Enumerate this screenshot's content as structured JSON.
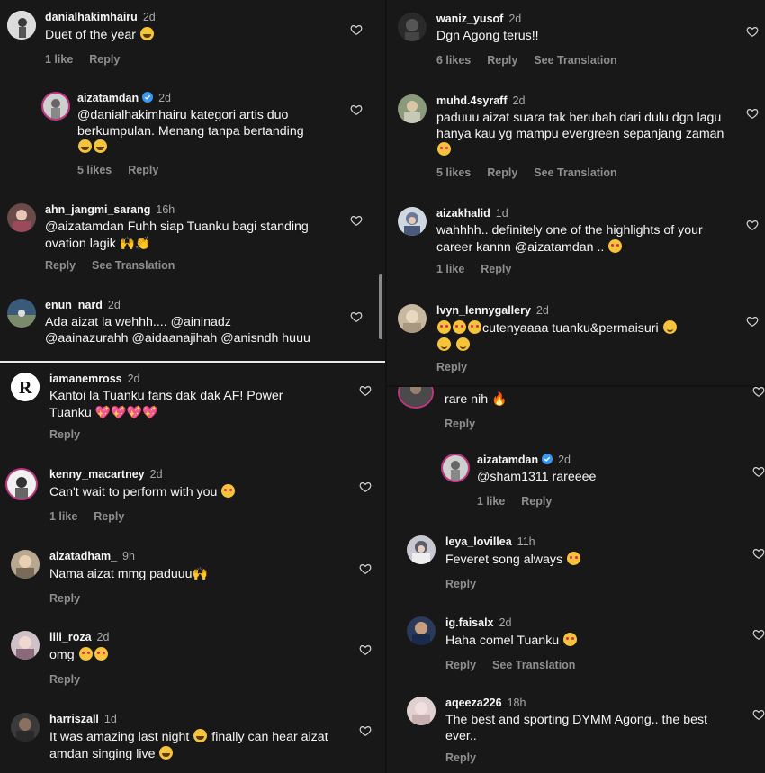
{
  "colors": {
    "background": "#181818",
    "text": "#f5f5f5",
    "muted": "#8e8e8e",
    "verified": "#3897f0"
  },
  "labels": {
    "reply": "Reply",
    "see_translation": "See Translation"
  },
  "top_left": [
    {
      "username": "danialhakimhairu",
      "time": "2d",
      "text": "Duet of the year",
      "emojis": "laugh",
      "likes": "1 like"
    },
    {
      "username": "aizatamdan",
      "verified": true,
      "time": "2d",
      "text": "@danialhakimhairu kategori artis duo berkumpulan. Menang tanpa bertanding",
      "emojis": "laugh laugh",
      "likes": "5 likes"
    },
    {
      "username": "ahn_jangmi_sarang",
      "time": "16h",
      "text": "@aizatamdan Fuhh siap Tuanku bagi standing ovation lagik",
      "emojis": "🙌👏",
      "translation": true
    },
    {
      "username": "enun_nard",
      "time": "2d",
      "text": "Ada aizat la wehhh.... @aininadz @aainazurahh @aidaanajihah @anisndh huuu"
    }
  ],
  "top_right": [
    {
      "username": "waniz_yusof",
      "time": "2d",
      "text": "Dgn Agong terus!!",
      "likes": "6 likes",
      "translation": true
    },
    {
      "username": "muhd.4syraff",
      "time": "2d",
      "text": "paduuu aizat suara tak berubah dari dulu dgn lagu hanya kau yg mampu evergreen sepanjang zaman",
      "emojis": "heart-e",
      "likes": "5 likes",
      "translation": true
    },
    {
      "username": "aizakhalid",
      "time": "1d",
      "text": "wahhhh.. definitely one of the highlights of your career kannn @aizatamdan ..",
      "emojis": "heart-e",
      "likes": "1 like"
    },
    {
      "username": "lvyn_lennygallery",
      "time": "2d",
      "text": "cutenyaaaa tuanku&permaisuri",
      "emojis": "heart-e heart-e heart-e"
    }
  ],
  "bottom_left": [
    {
      "username": "iamanemross",
      "time": "2d",
      "text": "Kantoi la Tuanku fans dak dak AF! Power Tuanku",
      "emojis": "💖💖💖💖"
    },
    {
      "username": "kenny_macartney",
      "time": "2d",
      "text": "Can't wait to perform with you",
      "emojis": "heart-e",
      "likes": "1 like"
    },
    {
      "username": "aizatadham_",
      "time": "9h",
      "text": "Nama aizat mmg paduuu",
      "emojis": "🙌"
    },
    {
      "username": "lili_roza",
      "time": "2d",
      "text": "omg",
      "emojis": "heart-e heart-e"
    },
    {
      "username": "harriszall",
      "time": "1d",
      "text": "It was amazing last night",
      "text2": "finally can hear aizat amdan singing live",
      "emojis": "laugh"
    }
  ],
  "bottom_right": [
    {
      "text": "rare nih",
      "emojis": "🔥"
    },
    {
      "username": "aizatamdan",
      "verified": true,
      "time": "2d",
      "text": "@sham1311 rareeee",
      "likes": "1 like"
    },
    {
      "username": "leya_lovillea",
      "time": "11h",
      "text": "Feveret song always",
      "emojis": "heart-e"
    },
    {
      "username": "ig.faisalx",
      "time": "2d",
      "text": "Haha comel Tuanku",
      "emojis": "heart-e",
      "translation": true
    },
    {
      "username": "aqeeza226",
      "time": "18h",
      "text": "The best and sporting DYMM Agong.. the best ever.."
    }
  ]
}
